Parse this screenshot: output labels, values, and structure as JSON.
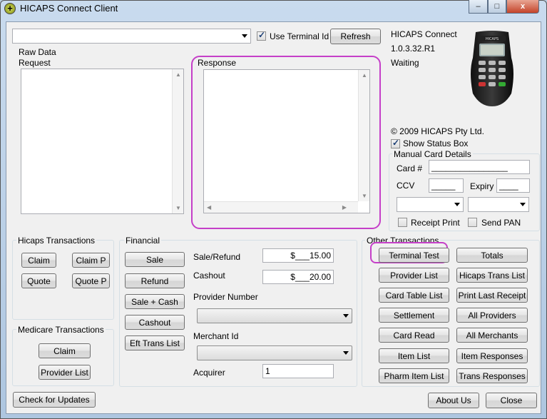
{
  "window": {
    "title": "HICAPS Connect Client"
  },
  "caption": {
    "minimize": "–",
    "maximize": "□",
    "close": "x"
  },
  "top": {
    "use_terminal_id": "Use Terminal Id",
    "use_terminal_checked": true,
    "refresh": "Refresh",
    "terminal_combo": ""
  },
  "info": {
    "app_name": "HICAPS Connect",
    "version": "1.0.3.32.R1",
    "status": "Waiting",
    "copyright": "© 2009 HICAPS Pty Ltd.",
    "show_status_box": "Show Status Box",
    "show_status_checked": true,
    "terminal_brand": "HICAPS"
  },
  "raw_data": {
    "legend": "Raw Data",
    "request_label": "Request",
    "response_label": "Response"
  },
  "manual_card": {
    "legend": "Manual Card Details",
    "card_label": "Card #",
    "card_value": "________________",
    "ccv_label": "CCV",
    "ccv_value": "_____",
    "expiry_label": "Expiry",
    "expiry_value": "____",
    "receipt_print": "Receipt Print",
    "send_pan": "Send PAN"
  },
  "hicaps_tx": {
    "legend": "Hicaps Transactions",
    "claim": "Claim",
    "claim_p": "Claim P",
    "quote": "Quote",
    "quote_p": "Quote P"
  },
  "medicare_tx": {
    "legend": "Medicare Transactions",
    "claim": "Claim",
    "provider_list": "Provider List"
  },
  "financial": {
    "legend": "Financial",
    "sale": "Sale",
    "refund": "Refund",
    "sale_cash": "Sale + Cash",
    "cashout": "Cashout",
    "eft_trans_list": "Eft Trans List",
    "sale_refund_label": "Sale/Refund",
    "sale_refund_value": "$___15.00",
    "cashout_label": "Cashout",
    "cashout_value": "$___20.00",
    "provider_number_label": "Provider Number",
    "merchant_id_label": "Merchant Id",
    "acquirer_label": "Acquirer",
    "acquirer_value": "1"
  },
  "other_tx": {
    "legend": "Other Transactions",
    "buttons": [
      "Terminal Test",
      "Totals",
      "Provider List",
      "Hicaps Trans List",
      "Card Table List",
      "Print Last Receipt",
      "Settlement",
      "All Providers",
      "Card Read",
      "All Merchants",
      "Item List",
      "Item Responses",
      "Pharm Item List",
      "Trans Responses"
    ]
  },
  "bottom": {
    "check_updates": "Check for Updates",
    "about": "About Us",
    "close": "Close"
  },
  "colors": {
    "highlight": "#c53fc8",
    "title_bar": "#b9cde2",
    "client_bg": "#f0f0f0"
  }
}
